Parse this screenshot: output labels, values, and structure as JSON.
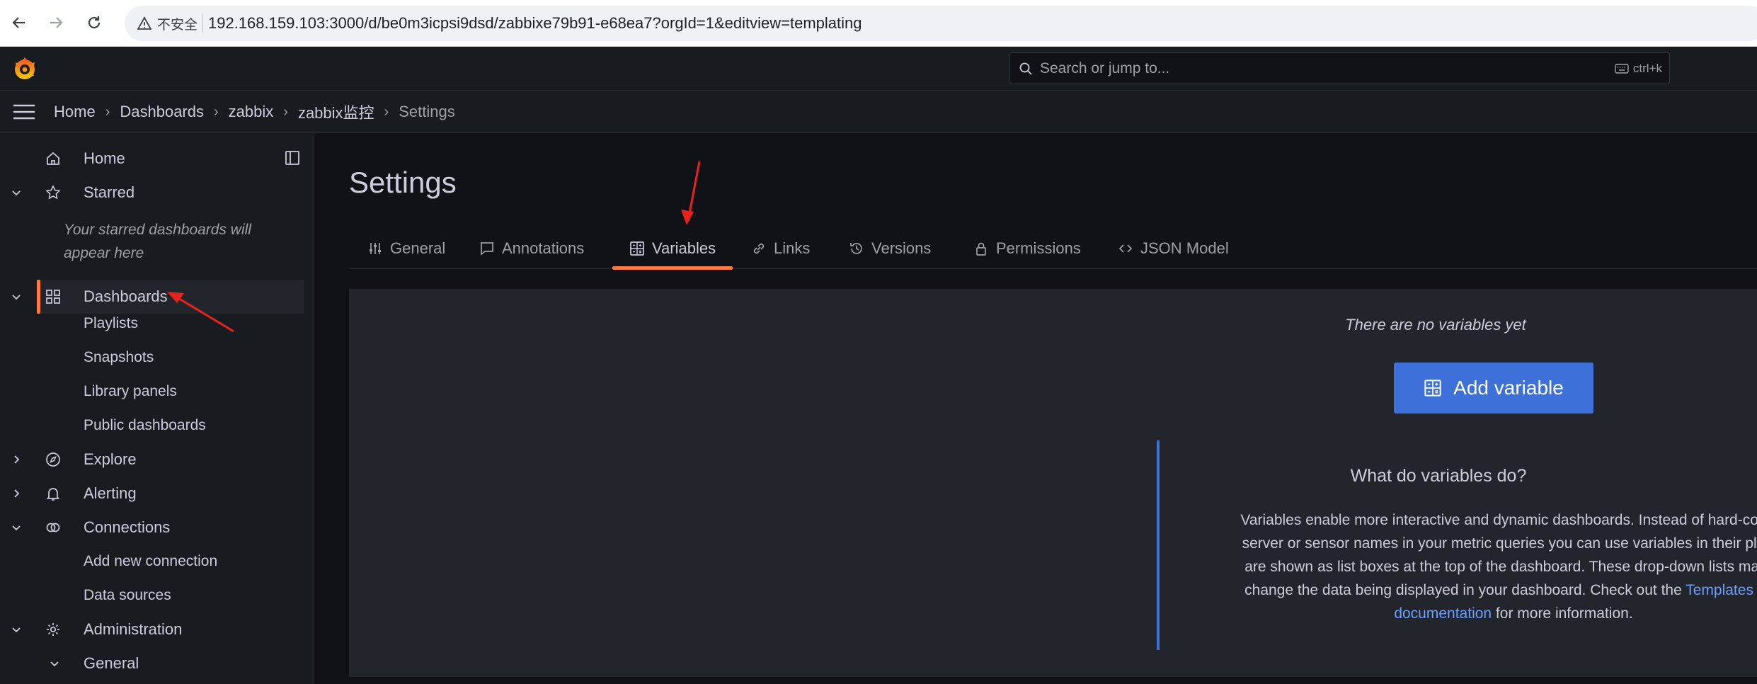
{
  "browser": {
    "security_label": "不安全",
    "url": "192.168.159.103:3000/d/be0m3icpsi9dsd/zabbixe79b91-e68ea7?orgId=1&editview=templating"
  },
  "topbar": {
    "search_placeholder": "Search or jump to...",
    "search_shortcut": "ctrl+k"
  },
  "breadcrumb": [
    "Home",
    "Dashboards",
    "zabbix",
    "zabbix监控",
    "Settings"
  ],
  "sidebar": {
    "items": [
      {
        "label": "Home",
        "icon": "home-icon"
      },
      {
        "label": "Starred",
        "icon": "star-icon"
      },
      {
        "label": "Dashboards",
        "icon": "apps-icon"
      },
      {
        "label": "Playlists"
      },
      {
        "label": "Snapshots"
      },
      {
        "label": "Library panels"
      },
      {
        "label": "Public dashboards"
      },
      {
        "label": "Explore",
        "icon": "compass-icon"
      },
      {
        "label": "Alerting",
        "icon": "bell-icon"
      },
      {
        "label": "Connections",
        "icon": "connections-icon"
      },
      {
        "label": "Add new connection"
      },
      {
        "label": "Data sources"
      },
      {
        "label": "Administration",
        "icon": "cog-icon"
      },
      {
        "label": "General"
      }
    ],
    "starred_empty": "Your starred dashboards will appear here"
  },
  "main": {
    "title": "Settings",
    "tabs": [
      {
        "label": "General",
        "icon": "sliders-icon"
      },
      {
        "label": "Annotations",
        "icon": "comment-icon"
      },
      {
        "label": "Variables",
        "icon": "calculator-icon"
      },
      {
        "label": "Links",
        "icon": "link-icon"
      },
      {
        "label": "Versions",
        "icon": "history-icon"
      },
      {
        "label": "Permissions",
        "icon": "lock-icon"
      },
      {
        "label": "JSON Model",
        "icon": "code-icon"
      }
    ],
    "active_tab": "Variables",
    "empty_text": "There are no variables yet",
    "add_button": "Add variable",
    "info_title": "What do variables do?",
    "info_lines": [
      "Variables enable more interactive and dynamic dashboards. Instead of hard-coding",
      "server or sensor names in your metric queries you can use variables in their place.",
      "are shown as list boxes at the top of the dashboard. These drop-down lists make i",
      "change the data being displayed in your dashboard. Check out the "
    ],
    "info_link_1": "Templates and",
    "info_link_2": "documentation",
    "info_tail": " for more information."
  },
  "colors": {
    "accent": "#ff7941",
    "primary": "#3d71d9",
    "link": "#6e9fff",
    "annotation_arrow": "#e8231e"
  }
}
